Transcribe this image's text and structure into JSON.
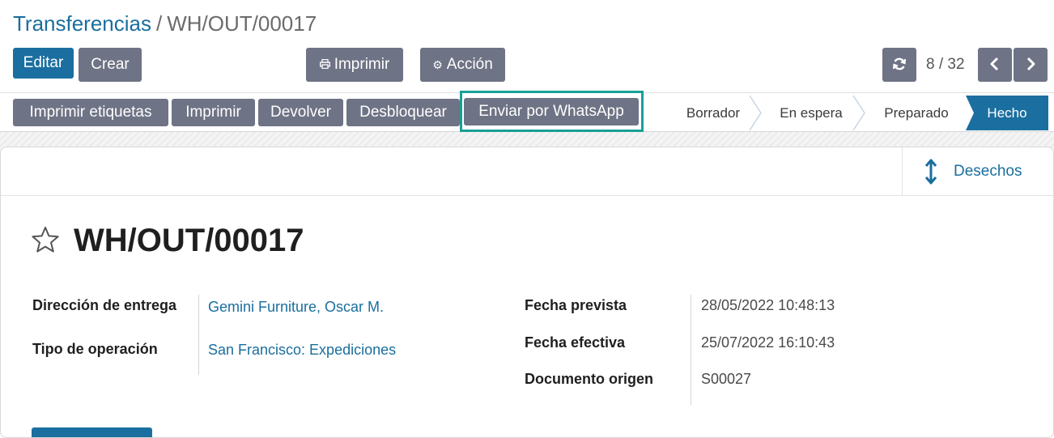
{
  "breadcrumb": {
    "parent": "Transferencias",
    "separator": "/",
    "current": "WH/OUT/00017"
  },
  "toolbar": {
    "edit_label": "Editar",
    "create_label": "Crear",
    "print_label": "Imprimir",
    "print_icon": "print-icon",
    "action_label": "Acción",
    "action_icon": "gear-icon"
  },
  "pager": {
    "value": "8 / 32",
    "refresh_icon": "refresh-icon",
    "prev_icon": "chevron-left-icon",
    "next_icon": "chevron-right-icon"
  },
  "statusbar": {
    "buttons": [
      {
        "label": "Imprimir etiquetas"
      },
      {
        "label": "Imprimir"
      },
      {
        "label": "Devolver"
      },
      {
        "label": "Desbloquear"
      },
      {
        "label": "Enviar por WhatsApp"
      }
    ],
    "stages": [
      "Borrador",
      "En espera",
      "Preparado",
      "Hecho"
    ],
    "active_stage": "Hecho"
  },
  "smart_buttons": {
    "scrap_label": "Desechos",
    "scrap_icon": "vertical-arrows-icon"
  },
  "record": {
    "title": "WH/OUT/00017",
    "favorite_icon": "star-outline-icon",
    "delivery_address_label": "Dirección de entrega",
    "delivery_address_value": "Gemini Furniture, Oscar M.",
    "operation_type_label": "Tipo de operación",
    "operation_type_value": "San Francisco: Expediciones",
    "scheduled_date_label": "Fecha prevista",
    "scheduled_date_value": "28/05/2022 10:48:13",
    "effective_date_label": "Fecha efectiva",
    "effective_date_value": "25/07/2022 16:10:43",
    "source_document_label": "Documento origen",
    "source_document_value": "S00027"
  },
  "colors": {
    "primary": "#1a6fa0",
    "secondary": "#6e7385",
    "link": "#1a6e9e",
    "highlight": "#17a096"
  }
}
